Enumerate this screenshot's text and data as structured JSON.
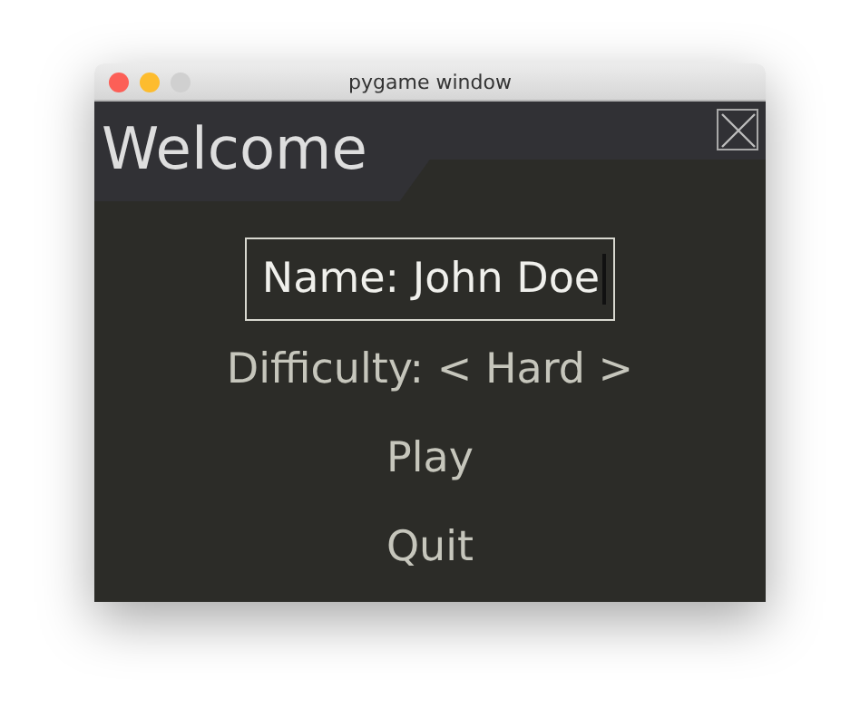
{
  "window": {
    "title": "pygame window"
  },
  "header": {
    "title": "Welcome"
  },
  "name_field": {
    "value": "Name: John Doe",
    "focused": true
  },
  "menu": [
    {
      "label": "Difficulty: < Hard >"
    },
    {
      "label": "Play"
    },
    {
      "label": "Quit"
    }
  ]
}
